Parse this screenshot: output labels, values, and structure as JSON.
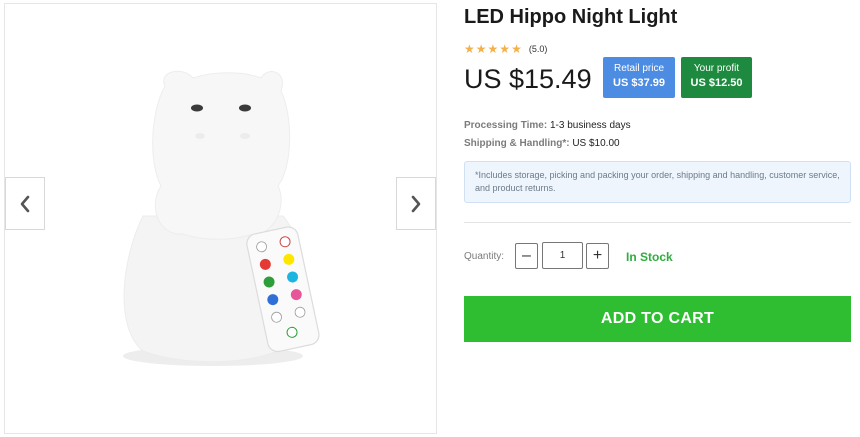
{
  "product": {
    "title": "LED Hippo Night Light",
    "rating": {
      "stars": 5,
      "text": "(5.0)",
      "star_color": "#f3b04b"
    },
    "price": "US $15.49",
    "retail": {
      "label": "Retail price",
      "value": "US $37.99",
      "color": "#4d8ce3"
    },
    "profit": {
      "label": "Your profit",
      "value": "US $12.50",
      "color": "#1d8a3f"
    },
    "processing": {
      "label": "Processing Time:",
      "value": "1-3 business days"
    },
    "shipping": {
      "label": "Shipping & Handling*:",
      "value": "US $10.00"
    },
    "note": "*Includes storage, picking and packing your order, shipping and handling, customer service, and product returns."
  },
  "gallery": {
    "prev_icon": "chevron-left-icon",
    "next_icon": "chevron-right-icon",
    "image": "hippo-night-light-with-remote"
  },
  "purchase": {
    "quantity_label": "Quantity:",
    "quantity_value": "1",
    "minus_symbol": "–",
    "plus_symbol": "+",
    "stock_status": "In Stock",
    "add_to_cart": "ADD TO CART",
    "button_color": "#2fbe32"
  }
}
